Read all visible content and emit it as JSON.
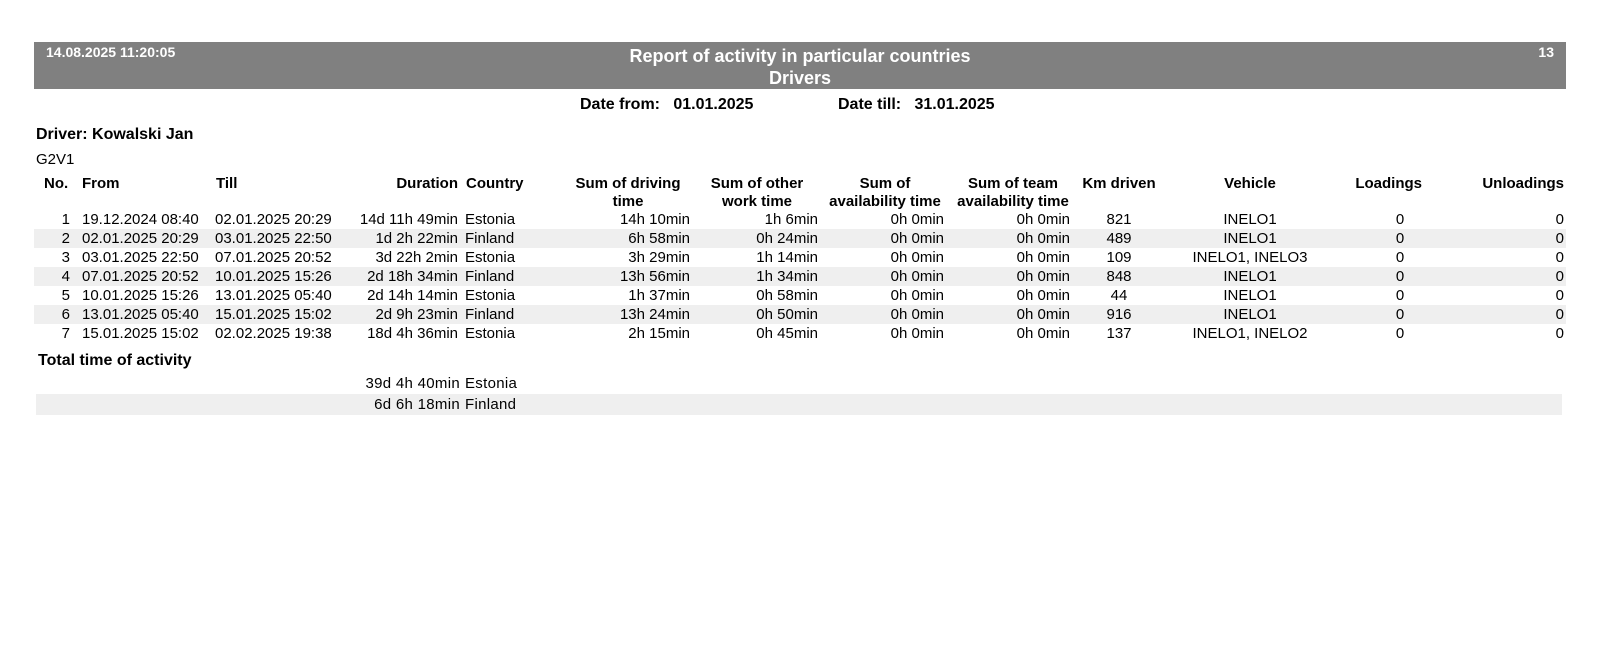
{
  "header": {
    "datetime": "14.08.2025  11:20:05",
    "title": "Report of activity in particular countries",
    "subtitle": "Drivers",
    "page_number": "13"
  },
  "date_range": {
    "from_label": "Date from:",
    "from_value": "01.01.2025",
    "till_label": "Date till:",
    "till_value": "31.01.2025"
  },
  "driver": {
    "label": "Driver: Kowalski Jan",
    "code": "G2V1"
  },
  "columns": {
    "no": "No.",
    "from": "From",
    "till": "Till",
    "duration": "Duration",
    "country": "Country",
    "driving": [
      "Sum of driving",
      "time"
    ],
    "other_work": [
      "Sum of other",
      "work time"
    ],
    "availability": [
      "Sum of",
      "availability time"
    ],
    "team_availability": [
      "Sum of team",
      "availability time"
    ],
    "km": "Km driven",
    "vehicle": "Vehicle",
    "loadings": "Loadings",
    "unloadings": "Unloadings"
  },
  "rows": [
    {
      "no": "1",
      "from": "19.12.2024  08:40",
      "till": "02.01.2025  20:29",
      "duration": "14d 11h 49min",
      "country": "Estonia",
      "driving": "14h 10min",
      "other": "1h 6min",
      "avail": "0h 0min",
      "team": "0h 0min",
      "km": "821",
      "vehicle": "INELO1",
      "loadings": "0",
      "unloadings": "0"
    },
    {
      "no": "2",
      "from": "02.01.2025  20:29",
      "till": "03.01.2025  22:50",
      "duration": "1d 2h 22min",
      "country": "Finland",
      "driving": "6h 58min",
      "other": "0h 24min",
      "avail": "0h 0min",
      "team": "0h 0min",
      "km": "489",
      "vehicle": "INELO1",
      "loadings": "0",
      "unloadings": "0"
    },
    {
      "no": "3",
      "from": "03.01.2025  22:50",
      "till": "07.01.2025  20:52",
      "duration": "3d 22h 2min",
      "country": "Estonia",
      "driving": "3h 29min",
      "other": "1h 14min",
      "avail": "0h 0min",
      "team": "0h 0min",
      "km": "109",
      "vehicle": "INELO1, INELO3",
      "loadings": "0",
      "unloadings": "0"
    },
    {
      "no": "4",
      "from": "07.01.2025  20:52",
      "till": "10.01.2025  15:26",
      "duration": "2d 18h 34min",
      "country": "Finland",
      "driving": "13h 56min",
      "other": "1h 34min",
      "avail": "0h 0min",
      "team": "0h 0min",
      "km": "848",
      "vehicle": "INELO1",
      "loadings": "0",
      "unloadings": "0"
    },
    {
      "no": "5",
      "from": "10.01.2025  15:26",
      "till": "13.01.2025  05:40",
      "duration": "2d 14h 14min",
      "country": "Estonia",
      "driving": "1h 37min",
      "other": "0h 58min",
      "avail": "0h 0min",
      "team": "0h 0min",
      "km": "44",
      "vehicle": "INELO1",
      "loadings": "0",
      "unloadings": "0"
    },
    {
      "no": "6",
      "from": "13.01.2025  05:40",
      "till": "15.01.2025  15:02",
      "duration": "2d 9h 23min",
      "country": "Finland",
      "driving": "13h 24min",
      "other": "0h 50min",
      "avail": "0h 0min",
      "team": "0h 0min",
      "km": "916",
      "vehicle": "INELO1",
      "loadings": "0",
      "unloadings": "0"
    },
    {
      "no": "7",
      "from": "15.01.2025  15:02",
      "till": "02.02.2025  19:38",
      "duration": "18d 4h 36min",
      "country": "Estonia",
      "driving": "2h 15min",
      "other": "0h 45min",
      "avail": "0h 0min",
      "team": "0h 0min",
      "km": "137",
      "vehicle": "INELO1, INELO2",
      "loadings": "0",
      "unloadings": "0"
    }
  ],
  "totals": {
    "title": "Total time of activity",
    "rows": [
      {
        "duration": "39d 4h 40min",
        "country": "Estonia"
      },
      {
        "duration": "6d 6h 18min",
        "country": "Finland"
      }
    ]
  },
  "colors": {
    "header_bg": "#808080",
    "header_text": "#ffffff",
    "row_alt_bg": "#efefef"
  }
}
